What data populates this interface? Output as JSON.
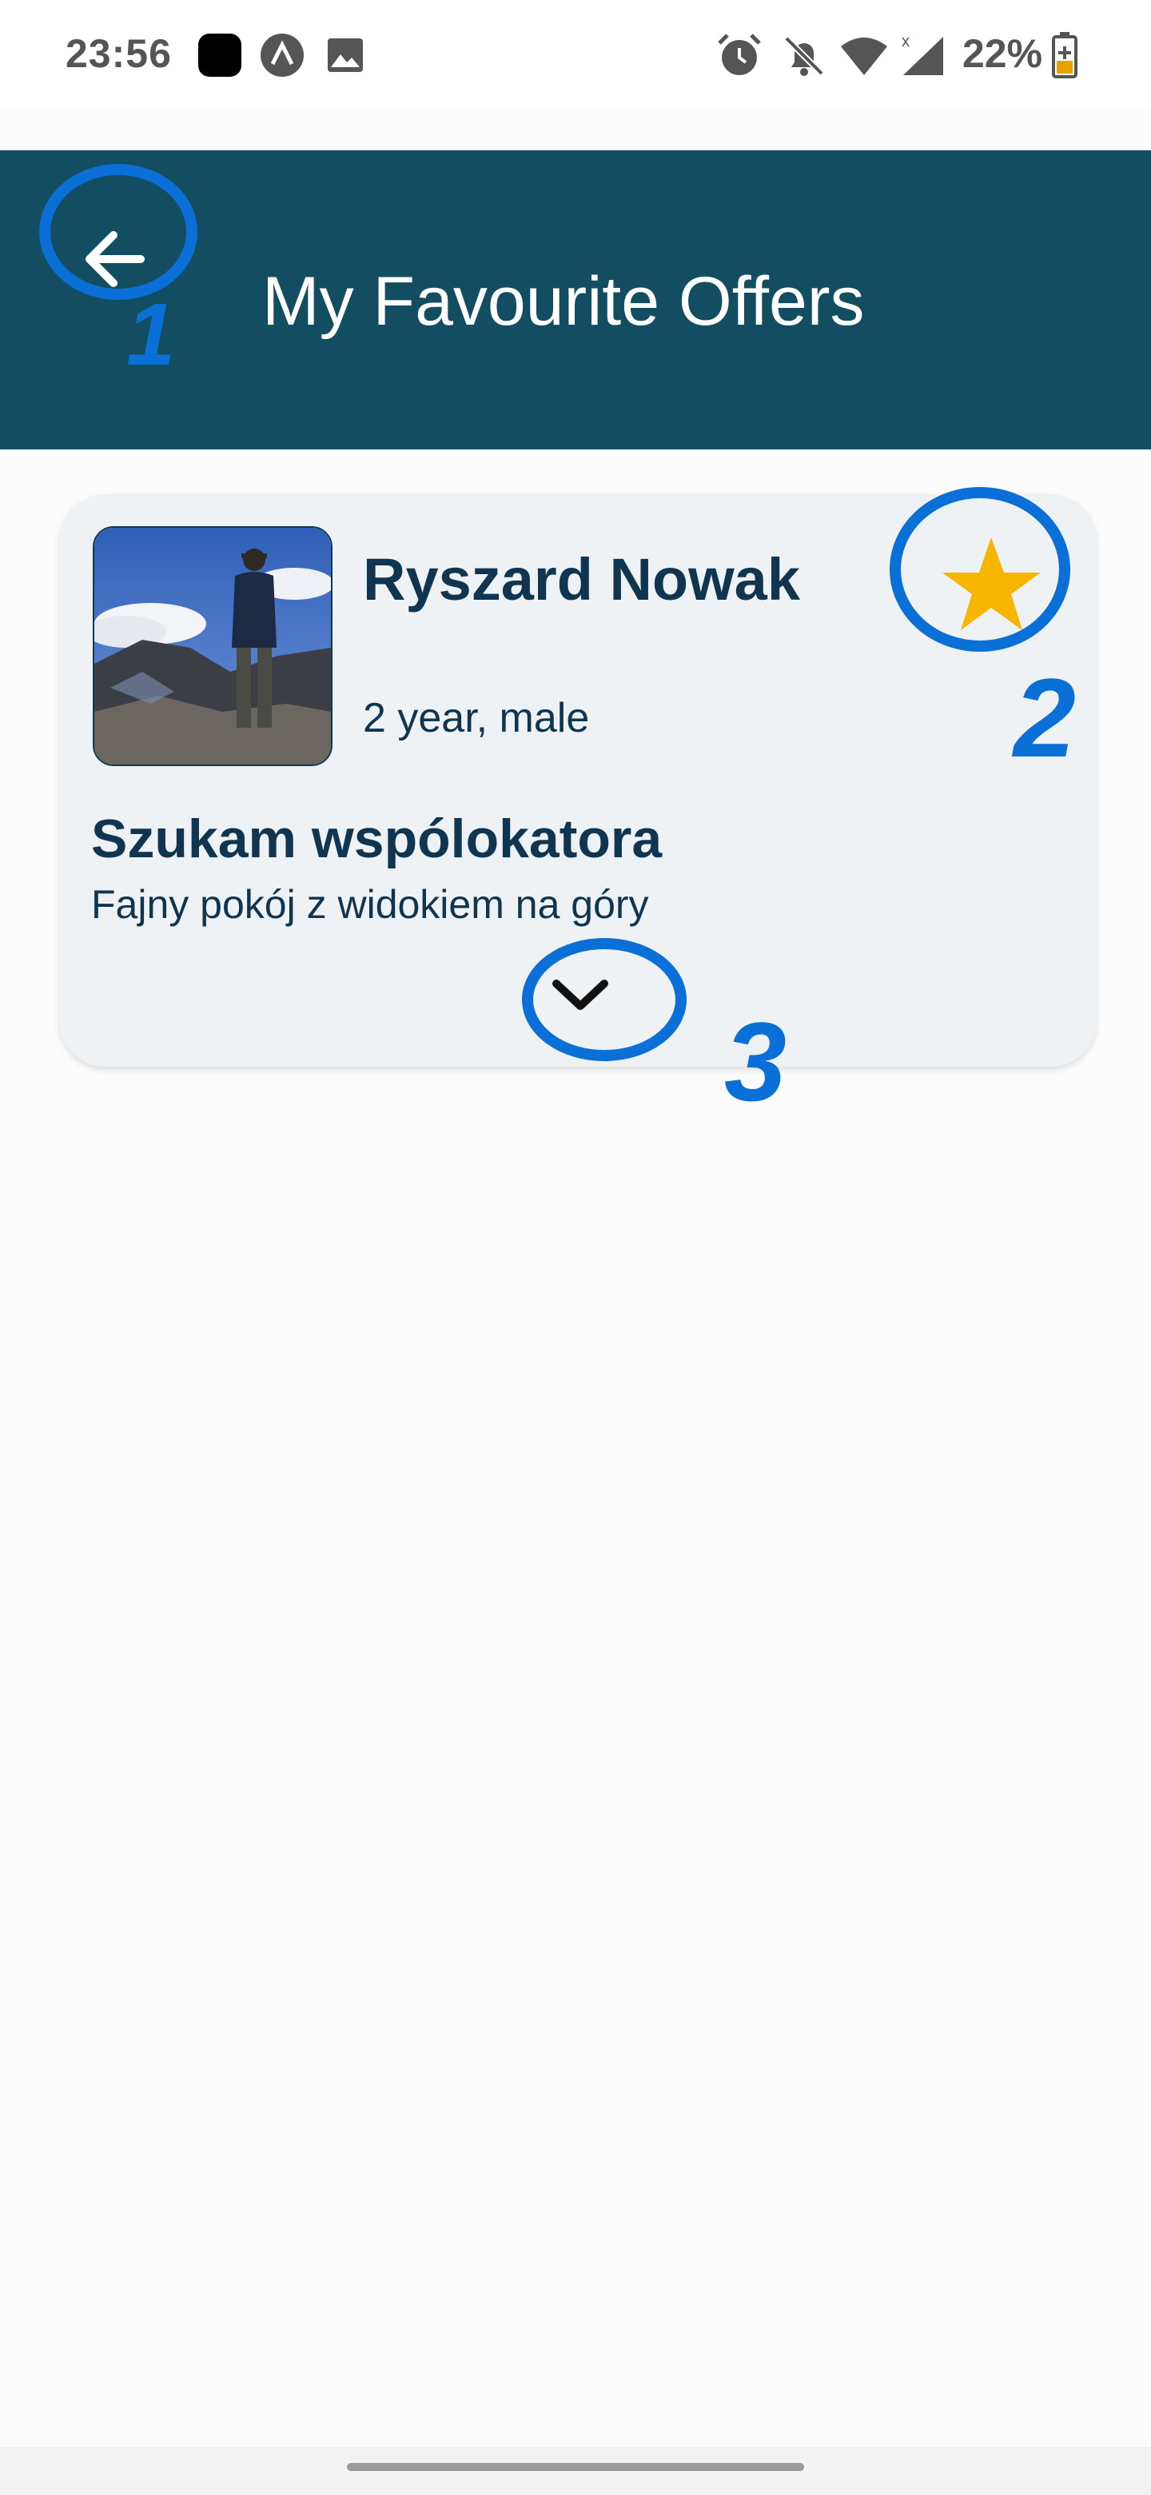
{
  "status_bar": {
    "time": "23:56",
    "battery_percent": "22%",
    "icons": [
      "app-icon",
      "expo-icon",
      "image-icon",
      "alarm-icon",
      "bell-off-icon",
      "wifi-icon",
      "signal-icon",
      "battery-charging-icon"
    ]
  },
  "app_bar": {
    "title": "My Favourite Offers",
    "back_icon": "arrow-left-icon",
    "background": "#134d61"
  },
  "offer": {
    "name": "Ryszard Nowak",
    "meta": "2 year, male",
    "title": "Szukam wspólokatora",
    "description": "Fajny pokój z widokiem na góry",
    "favourite": true,
    "star_color": "#f7b500",
    "expand_icon": "chevron-down-icon"
  },
  "annotations": {
    "color": "#0a6fd6",
    "labels": [
      "1",
      "2",
      "3"
    ]
  }
}
